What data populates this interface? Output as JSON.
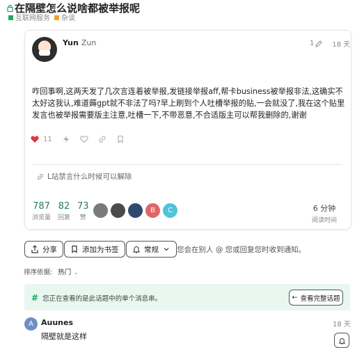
{
  "topic": {
    "title": "在隔壁怎么说啥都被举报呢"
  },
  "breadcrumb": [
    {
      "label": "互联网服务",
      "color": "#1aab62"
    },
    {
      "label": "杂谈",
      "color": "#f1a12b"
    }
  ],
  "post": {
    "username": "Yun",
    "fullname": "Zun",
    "edit_count": "1",
    "time": "18 天",
    "body": "咋回事啊,这两天发了几次言连着被举报,发链接举报aff,帮卡business被举报非法,这确实不太好这我认,难道薅gpt就不非法了吗?早上刷到个人吐槽举报的贴,一会就没了,我在这个贴里发言也被举报需要版主注意,吐槽一下,不带恶意,不合适版主可以帮我删除的,谢谢",
    "likes": "11",
    "linked_topic": "L站禁言什么时候可以解除"
  },
  "stats": [
    {
      "value": "787",
      "label": "浏览量"
    },
    {
      "value": "82",
      "label": "回复"
    },
    {
      "value": "73",
      "label": "赞"
    }
  ],
  "participants": [
    {
      "initial": "",
      "color": "#7a7a7a"
    },
    {
      "initial": "",
      "color": "#4b4b4b"
    },
    {
      "initial": "",
      "color": "#2f4a6e"
    },
    {
      "initial": "B",
      "color": "#e06666"
    },
    {
      "initial": "C",
      "color": "#4fc3d9"
    }
  ],
  "read_time": {
    "value": "6 分钟",
    "label": "阅读时间"
  },
  "footer": {
    "share": "分享",
    "bookmark": "添加为书签",
    "notify": "常规",
    "notice": "您会在别人 @ 您或回复您时收到通知。"
  },
  "sort": {
    "label": "排序依据:",
    "value": "热门"
  },
  "banner": {
    "text": "您正在查看的是此话题中的单个消息串。",
    "button": "查看完整话题"
  },
  "reply": {
    "initial": "A",
    "username": "Auunes",
    "time": "18 天",
    "text": "隔壁就是这样"
  }
}
